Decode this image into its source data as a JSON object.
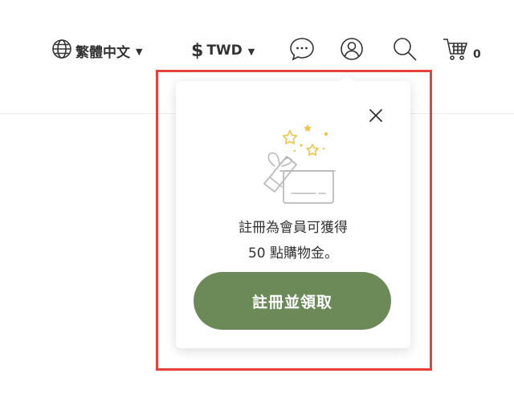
{
  "header": {
    "language": {
      "label": "繁體中文",
      "icon": "globe-icon"
    },
    "currency": {
      "symbol": "$",
      "label": "TWD",
      "icon": "dollar-icon"
    },
    "icons": [
      "chat-icon",
      "user-icon",
      "search-icon",
      "cart-icon"
    ],
    "cart_count": "0"
  },
  "popup": {
    "close_icon": "close-icon",
    "illustration": "gift-box-icon",
    "message_line1": "註冊為會員可獲得",
    "message_line2": "50 點購物金。",
    "cta_label": "註冊並領取"
  },
  "colors": {
    "cta": "#6b8a58",
    "highlight": "#e6413a",
    "stars": "#f0c24a",
    "text": "#333333"
  }
}
